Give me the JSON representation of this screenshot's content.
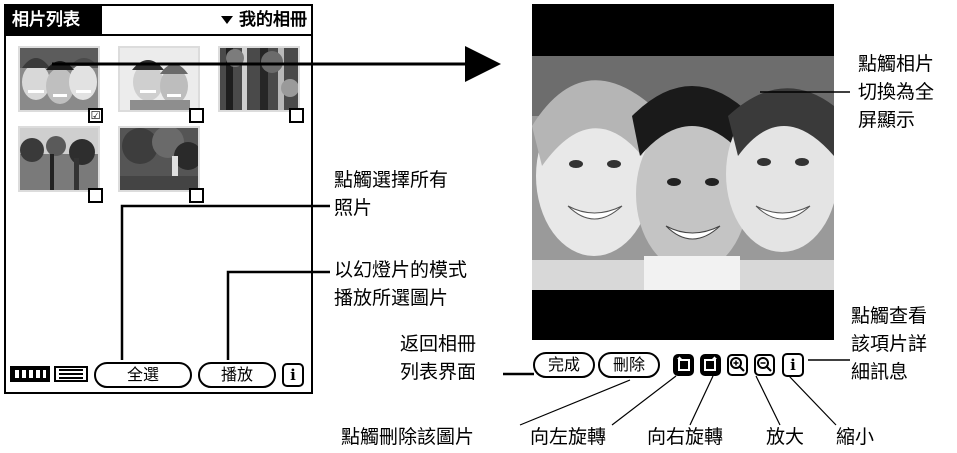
{
  "list_screen": {
    "title": "相片列表",
    "album_selector": "我的相冊",
    "thumbnails": [
      {
        "name": "thumb-friends-three",
        "checked": true,
        "check_glyph": "☑"
      },
      {
        "name": "thumb-couple",
        "checked": false,
        "check_glyph": ""
      },
      {
        "name": "thumb-forest-1",
        "checked": false,
        "check_glyph": ""
      },
      {
        "name": "thumb-forest-2",
        "checked": false,
        "check_glyph": ""
      },
      {
        "name": "thumb-tree-statue",
        "checked": false,
        "check_glyph": ""
      }
    ],
    "select_all_label": "全選",
    "play_label": "播放",
    "info_label": "i"
  },
  "view_screen": {
    "done_label": "完成",
    "delete_label": "刪除",
    "rotate_left_icon": "rotate-left-icon",
    "rotate_right_icon": "rotate-right-icon",
    "zoom_in_icon": "zoom-in-icon",
    "zoom_out_icon": "zoom-out-icon",
    "info_label": "i"
  },
  "annotations": {
    "tap_photo_fullscreen": [
      "點觸相片",
      "切換為全",
      "屏顯示"
    ],
    "select_all": [
      "點觸選擇所有",
      "照片"
    ],
    "slideshow": [
      "以幻燈片的模式",
      "播放所選圖片"
    ],
    "back_to_list": [
      "返回相冊",
      "列表界面"
    ],
    "view_details": [
      "點觸查看",
      "該項片詳",
      "細訊息"
    ],
    "delete_photo": "點觸刪除該圖片",
    "rotate_left": "向左旋轉",
    "rotate_right": "向右旋轉",
    "zoom_in": "放大",
    "zoom_out": "縮小"
  }
}
